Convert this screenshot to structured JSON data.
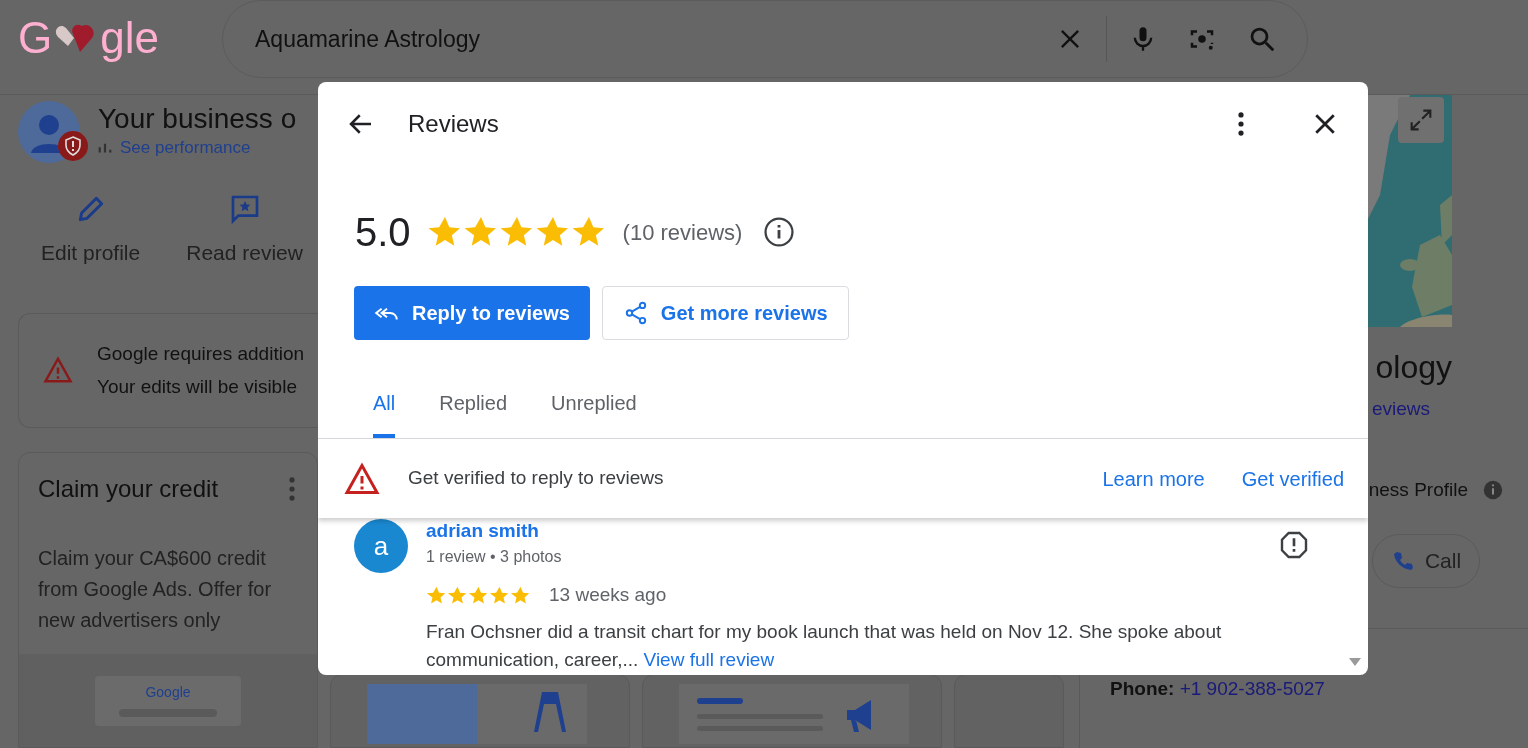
{
  "header": {
    "logo_start": "G",
    "logo_end": "gle",
    "search": {
      "value": "Aquamarine Astrology"
    }
  },
  "profile": {
    "title": "Your business o",
    "link": "See performance",
    "actions": [
      {
        "label": "Edit profile",
        "kind": "edit"
      },
      {
        "label": "Read review",
        "kind": "reviews"
      }
    ]
  },
  "notice": {
    "lines": [
      "Google requires addition",
      "Your edits will be visible"
    ]
  },
  "credit_card": {
    "title": "Claim your credit",
    "text": "Claim your CA$600 credit from Google Ads. Offer for new advertisers only",
    "logo": "Google"
  },
  "right_panel": {
    "title": "ology",
    "reviews_link": "eviews",
    "profile_label": "ness Profile",
    "call": "Call",
    "phone_label": "Phone:",
    "phone": "+1 902-388-5027"
  },
  "dialog": {
    "title": "Reviews",
    "rating": "5.0",
    "stars": 5,
    "count": "(10 reviews)",
    "buttons": [
      {
        "label": "Reply to reviews",
        "kind": "primary"
      },
      {
        "label": "Get more reviews",
        "kind": "outline"
      }
    ],
    "tabs": [
      {
        "label": "All",
        "selected": true
      },
      {
        "label": "Replied",
        "selected": false
      },
      {
        "label": "Unreplied",
        "selected": false
      }
    ],
    "banner": {
      "text": "Get verified to reply to reviews",
      "links": [
        "Learn more",
        "Get verified"
      ]
    },
    "reviews": [
      {
        "initial": "a",
        "name": "adrian smith",
        "meta": "1 review • 3 photos",
        "stars": 5,
        "time": "13 weeks ago",
        "text": "Fran Ochsner did a transit chart for my book launch that was held on Nov 12. She spoke about communication, career,...",
        "more": "View full review"
      }
    ]
  }
}
